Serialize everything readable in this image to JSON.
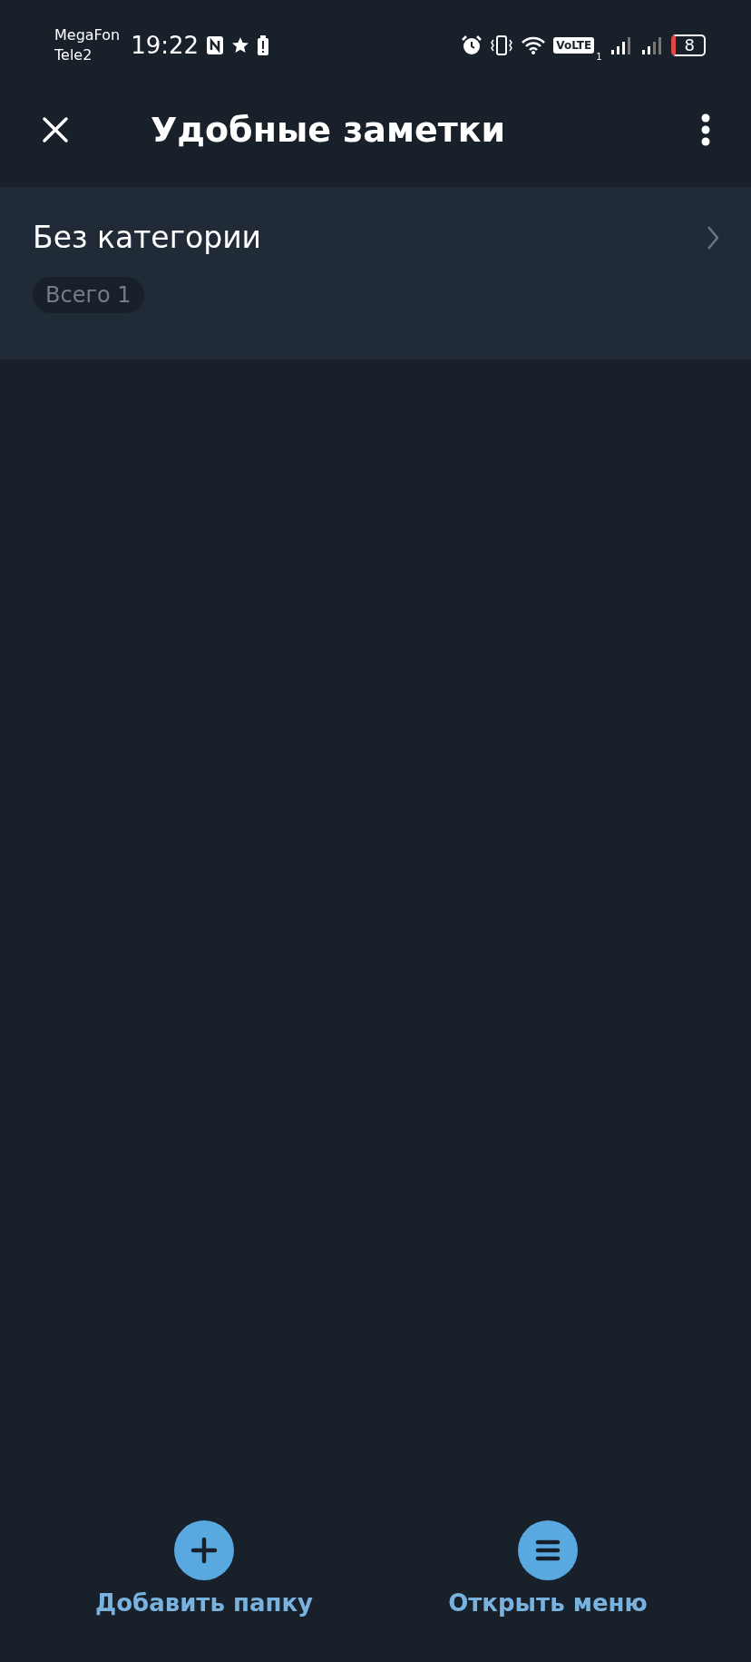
{
  "status_bar": {
    "carriers": [
      "MegaFon",
      "Tele2"
    ],
    "time": "19:22",
    "volte": "VoLTE",
    "sim": "1",
    "battery": "8"
  },
  "app_bar": {
    "title": "Удобные заметки"
  },
  "folders": [
    {
      "name": "Без категории",
      "count": "Всего 1"
    }
  ],
  "bottom_actions": [
    {
      "kind": "add",
      "label": "Добавить папку"
    },
    {
      "kind": "menu",
      "label": "Открыть меню"
    }
  ]
}
